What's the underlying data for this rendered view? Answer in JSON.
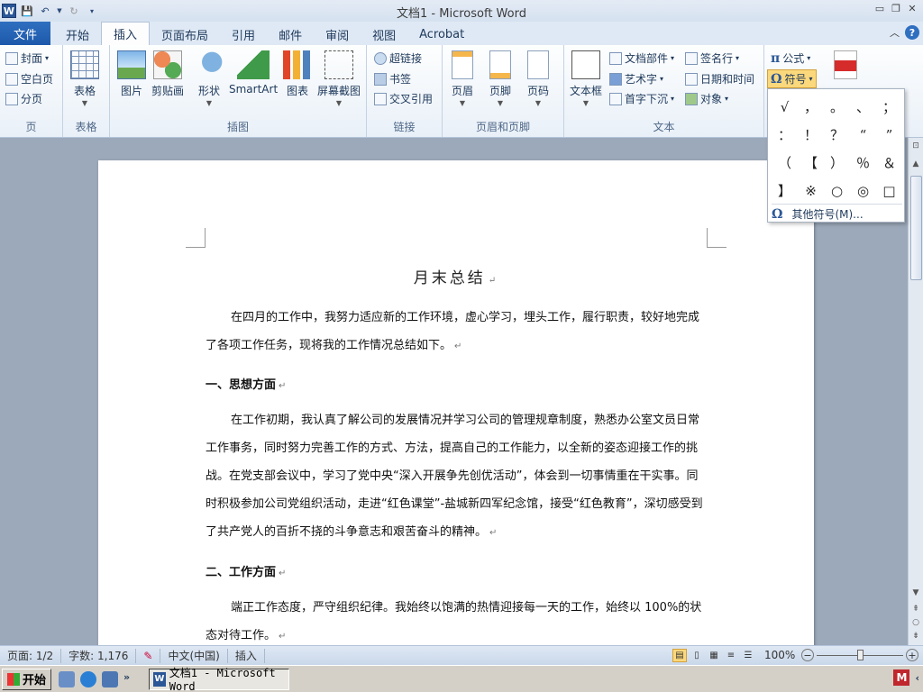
{
  "window": {
    "title": "文档1 - Microsoft Word",
    "word_logo": "W"
  },
  "tabs": {
    "file": "文件",
    "items": [
      "开始",
      "插入",
      "页面布局",
      "引用",
      "邮件",
      "审阅",
      "视图",
      "Acrobat"
    ],
    "active": "插入"
  },
  "ribbon": {
    "pages": {
      "label": "页",
      "cover": "封面",
      "blank": "空白页",
      "break": "分页"
    },
    "tables": {
      "label": "表格",
      "table": "表格"
    },
    "illustrations": {
      "label": "插图",
      "picture": "图片",
      "clipart": "剪贴画",
      "shapes": "形状",
      "smartart": "SmartArt",
      "chart": "图表",
      "screenshot": "屏幕截图"
    },
    "links": {
      "label": "链接",
      "hyperlink": "超链接",
      "bookmark": "书签",
      "crossref": "交叉引用"
    },
    "header_footer": {
      "label": "页眉和页脚",
      "header": "页眉",
      "footer": "页脚",
      "page_number": "页码"
    },
    "text": {
      "label": "文本",
      "textbox": "文本框",
      "quickparts": "文档部件",
      "wordart": "艺术字",
      "dropcap": "首字下沉",
      "signature": "签名行",
      "datetime": "日期和时间",
      "object": "对象"
    },
    "symbols": {
      "equation": "公式",
      "symbol": "符号"
    }
  },
  "symbol_dropdown": {
    "symbols": [
      "√",
      "，",
      "。",
      "、",
      "；",
      "：",
      "！",
      "？",
      "“",
      "”",
      "（",
      "【",
      "）",
      "％",
      "＆",
      "】",
      "※",
      "○",
      "◎",
      "□"
    ],
    "more": "其他符号(M)..."
  },
  "document": {
    "title": "月末总结",
    "intro": "在四月的工作中，我努力适应新的工作环境，虚心学习，埋头工作，履行职责，较好地完成了各项工作任务，现将我的工作情况总结如下。",
    "heading1": "一、思想方面",
    "para1": "在工作初期，我认真了解公司的发展情况并学习公司的管理规章制度，熟悉办公室文员日常工作事务，同时努力完善工作的方式、方法，提高自己的工作能力，以全新的姿态迎接工作的挑战。在党支部会议中，学习了党中央“深入开展争先创优活动”，体会到一切事情重在干实事。同时积极参加公司党组织活动，走进“红色课堂”-盐城新四军纪念馆，接受“红色教育”，深切感受到了共产党人的百折不挠的斗争意志和艰苦奋斗的精神。",
    "heading2": "二、工作方面",
    "para2": "端正工作态度，严守组织纪律。我始终以饱满的热情迎接每一天的工作，始终以 100%的状态对待工作。"
  },
  "statusbar": {
    "page": "页面: 1/2",
    "words": "字数: 1,176",
    "language": "中文(中国)",
    "mode": "插入",
    "zoom": "100%"
  },
  "taskbar": {
    "start": "开始",
    "window_item": "文档1 - Microsoft Word",
    "tray_icon": "M"
  }
}
